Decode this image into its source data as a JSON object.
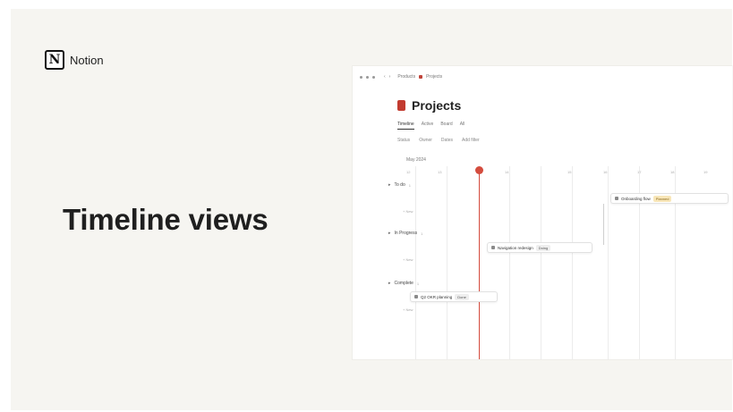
{
  "brand": {
    "name": "Notion",
    "logo_letter": "N"
  },
  "headline": "Timeline views",
  "app": {
    "breadcrumb": [
      "Products",
      "Projects"
    ],
    "page_title": "Projects",
    "tabs": [
      "Timeline",
      "Active",
      "Board",
      "All"
    ],
    "filters": [
      "Status",
      "Owner",
      "Dates",
      "Add filter"
    ],
    "month_label": "May 2024",
    "columns": [
      "12",
      "13",
      "14",
      "15",
      "16",
      "17",
      "18",
      "19"
    ],
    "groups": [
      {
        "label": "To do",
        "count": "1"
      },
      {
        "label": "In Progress",
        "count": "1"
      },
      {
        "label": "Complete",
        "count": "1"
      }
    ],
    "new_label": "+ New",
    "tasks": [
      {
        "label": "Onboarding flow",
        "status": "Planned"
      },
      {
        "label": "Navigation redesign",
        "status": "Doing"
      },
      {
        "label": "Q2 OKR planning",
        "status": "Done"
      }
    ]
  }
}
